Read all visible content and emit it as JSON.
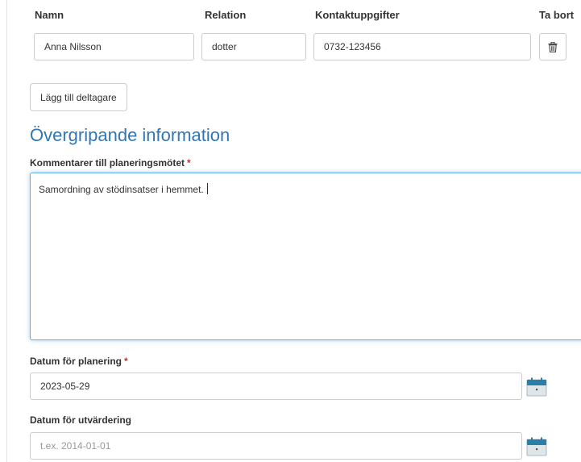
{
  "participants_table": {
    "headers": {
      "name": "Namn",
      "relation": "Relation",
      "contact": "Kontaktuppgifter",
      "remove": "Ta bort"
    },
    "rows": [
      {
        "name": "Anna Nilsson",
        "relation": "dotter",
        "contact": "0732-123456",
        "remove_icon": "trash-icon"
      }
    ]
  },
  "add_participant_label": "Lägg till deltagare",
  "section_title": "Övergripande information",
  "comments": {
    "label": "Kommentarer till planeringsmötet",
    "required_marker": "*",
    "value": "Samordning av stödinsatser i hemmet."
  },
  "planning_date": {
    "label": "Datum för planering",
    "required_marker": "*",
    "value": "2023-05-29",
    "icon": "calendar-icon"
  },
  "evaluation_date": {
    "label": "Datum för utvärdering",
    "placeholder": "t.ex. 2014-01-01",
    "value": "",
    "icon": "calendar-icon"
  },
  "colors": {
    "heading": "#3277b3",
    "required": "#c9302c",
    "focus_border": "#66afe9",
    "calendar_top": "#2a7fa8",
    "calendar_body": "#dfe6ea"
  }
}
